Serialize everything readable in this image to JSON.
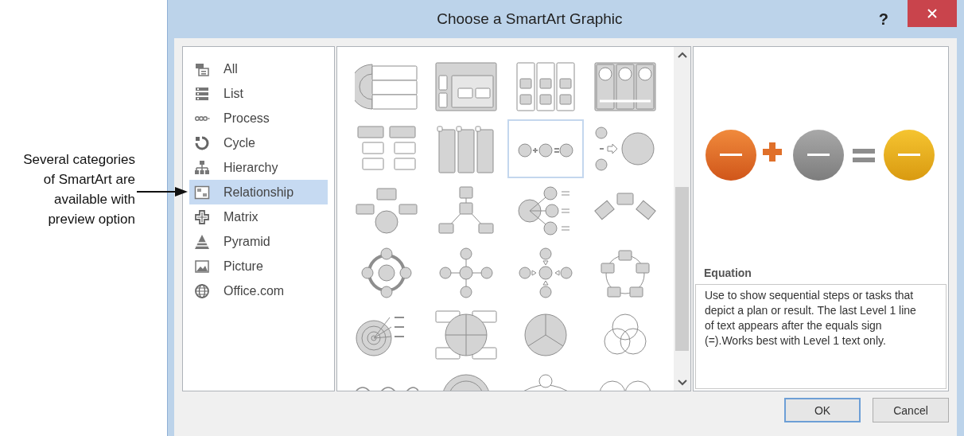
{
  "annotation": {
    "text": "Several categories of SmartArt are available with preview option"
  },
  "dialog": {
    "title": "Choose a SmartArt Graphic",
    "help_button": "?"
  },
  "categories": [
    {
      "label": "All",
      "selected": false
    },
    {
      "label": "List",
      "selected": false
    },
    {
      "label": "Process",
      "selected": false
    },
    {
      "label": "Cycle",
      "selected": false
    },
    {
      "label": "Hierarchy",
      "selected": false
    },
    {
      "label": "Relationship",
      "selected": true
    },
    {
      "label": "Matrix",
      "selected": false
    },
    {
      "label": "Pyramid",
      "selected": false
    },
    {
      "label": "Picture",
      "selected": false
    },
    {
      "label": "Office.com",
      "selected": false
    }
  ],
  "gallery": {
    "items": [
      {
        "kind": "table",
        "selected": false
      },
      {
        "kind": "nested",
        "selected": false
      },
      {
        "kind": "columns",
        "selected": false
      },
      {
        "kind": "panels",
        "selected": false
      },
      {
        "kind": "boxes",
        "selected": false
      },
      {
        "kind": "tabs",
        "selected": false
      },
      {
        "kind": "equation",
        "selected": true
      },
      {
        "kind": "merge",
        "selected": false
      },
      {
        "kind": "converge",
        "selected": false
      },
      {
        "kind": "hub",
        "selected": false
      },
      {
        "kind": "bullets",
        "selected": false
      },
      {
        "kind": "arc",
        "selected": false
      },
      {
        "kind": "ring",
        "selected": false
      },
      {
        "kind": "radial",
        "selected": false
      },
      {
        "kind": "arrows",
        "selected": false
      },
      {
        "kind": "cycle",
        "selected": false
      },
      {
        "kind": "target",
        "selected": false
      },
      {
        "kind": "matrix",
        "selected": false
      },
      {
        "kind": "pie",
        "selected": false
      },
      {
        "kind": "venn",
        "selected": false
      },
      {
        "kind": "wave",
        "selected": false
      },
      {
        "kind": "dome",
        "selected": false
      },
      {
        "kind": "balance",
        "selected": false
      },
      {
        "kind": "circles",
        "selected": false
      }
    ]
  },
  "preview": {
    "title": "Equation",
    "description": "Use to show sequential steps or tasks that depict a plan or result. The last Level 1 line of text appears after the equals sign (=).Works best with Level 1 text only."
  },
  "buttons": [
    {
      "label": "OK",
      "default": true
    },
    {
      "label": "Cancel",
      "default": false
    }
  ]
}
